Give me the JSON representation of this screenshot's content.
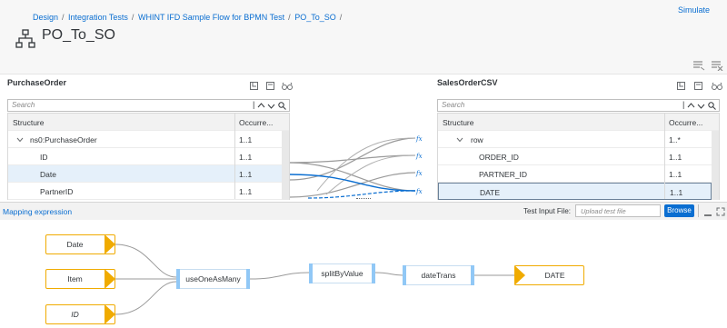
{
  "breadcrumb": {
    "items": [
      "Design",
      "Integration Tests",
      "WHINT IFD Sample Flow for BPMN Test",
      "PO_To_SO"
    ],
    "sep": "/"
  },
  "header": {
    "title": "PO_To_SO",
    "simulate": "Simulate"
  },
  "source": {
    "title": "PurchaseOrder",
    "search_placeholder": "Search",
    "col_structure": "Structure",
    "col_occurrence": "Occurre...",
    "rows": [
      {
        "name": "ns0:PurchaseOrder",
        "occ": "1..1"
      },
      {
        "name": "ID",
        "occ": "1..1"
      },
      {
        "name": "Date",
        "occ": "1..1"
      },
      {
        "name": "PartnerID",
        "occ": "1..1"
      }
    ]
  },
  "target": {
    "title": "SalesOrderCSV",
    "search_placeholder": "Search",
    "col_structure": "Structure",
    "col_occurrence": "Occurre...",
    "rows": [
      {
        "name": "row",
        "occ": "1..*"
      },
      {
        "name": "ORDER_ID",
        "occ": "1..1"
      },
      {
        "name": "PARTNER_ID",
        "occ": "1..1"
      },
      {
        "name": "DATE",
        "occ": "1..1"
      }
    ]
  },
  "mapping": {
    "label": "Mapping expression",
    "test_input_label": "Test Input File:",
    "upload_placeholder": "Upload test file",
    "browse": "Browse",
    "sources": [
      "Date",
      "Item",
      "ID"
    ],
    "functions": [
      "useOneAsMany",
      "splitByValue",
      "dateTrans"
    ],
    "target": "DATE"
  },
  "colors": {
    "accent": "#0a6ed1",
    "node_orange": "#f0ab00",
    "node_blue": "#91c8f6"
  }
}
